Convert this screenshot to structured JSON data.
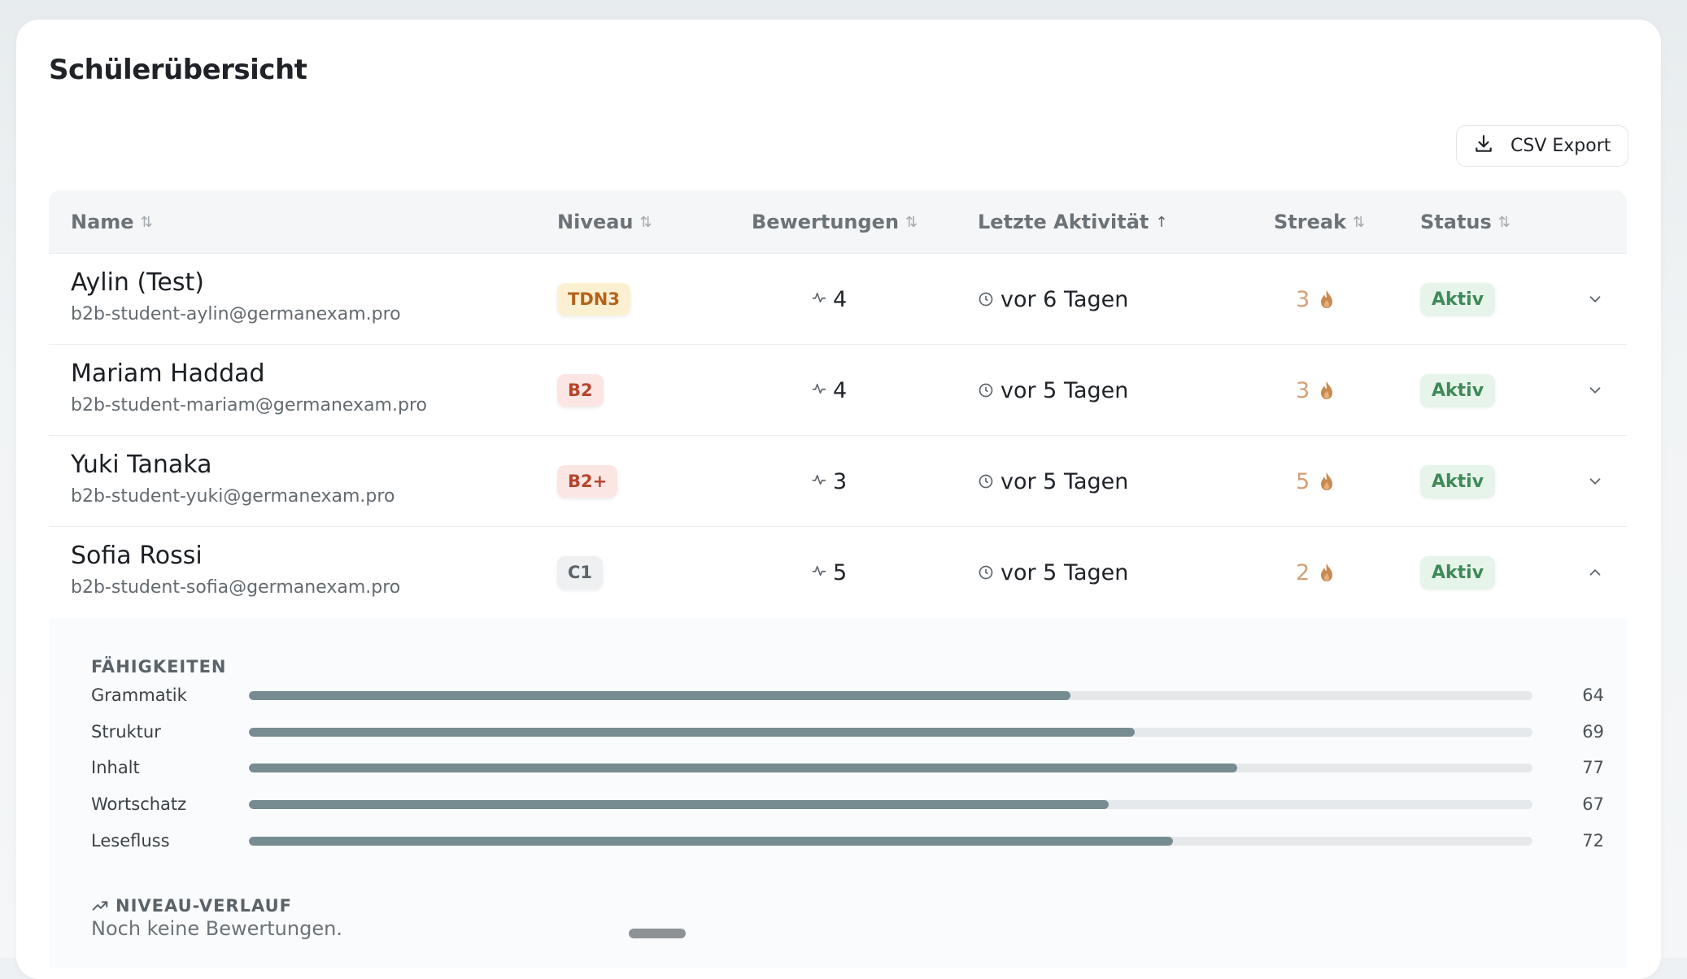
{
  "page": {
    "title": "Schülerübersicht"
  },
  "toolbar": {
    "export_label": "CSV Export"
  },
  "table": {
    "headers": {
      "name": "Name",
      "level": "Niveau",
      "ratings": "Bewertungen",
      "activity": "Letzte Aktivität",
      "streak": "Streak",
      "status": "Status"
    },
    "sort_icons": {
      "unsorted": "⇅",
      "ascending": "↑"
    },
    "rows": [
      {
        "name": "Aylin (Test)",
        "email": "b2b-student-aylin@germanexam.pro",
        "level": "TDN3",
        "ratings": "4",
        "activity": "vor 6 Tagen",
        "streak": "3",
        "status": "Aktiv"
      },
      {
        "name": "Mariam Haddad",
        "email": "b2b-student-mariam@germanexam.pro",
        "level": "B2",
        "ratings": "4",
        "activity": "vor 5 Tagen",
        "streak": "3",
        "status": "Aktiv"
      },
      {
        "name": "Yuki Tanaka",
        "email": "b2b-student-yuki@germanexam.pro",
        "level": "B2+",
        "ratings": "3",
        "activity": "vor 5 Tagen",
        "streak": "5",
        "status": "Aktiv"
      },
      {
        "name": "Sofia Rossi",
        "email": "b2b-student-sofia@germanexam.pro",
        "level": "C1",
        "ratings": "5",
        "activity": "vor 5 Tagen",
        "streak": "2",
        "status": "Aktiv"
      }
    ]
  },
  "details": {
    "skills_title": "FÄHIGKEITEN",
    "skills": [
      {
        "label": "Grammatik",
        "value": "64"
      },
      {
        "label": "Struktur",
        "value": "69"
      },
      {
        "label": "Inhalt",
        "value": "77"
      },
      {
        "label": "Wortschatz",
        "value": "67"
      },
      {
        "label": "Lesefluss",
        "value": "72"
      }
    ],
    "history_title": "NIVEAU-VERLAUF",
    "history_empty": "Noch keine Bewertungen."
  },
  "colors": {
    "level_tdn3_bg": "#fbf1d2",
    "level_tdn3_fg": "#b5621d",
    "level_b2_bg": "#fbe6e3",
    "level_b2_fg": "#b6452d",
    "level_c1_bg": "#eef0f2",
    "level_c1_fg": "#5b6469",
    "status_bg": "#e6f4ea",
    "status_fg": "#3f8a58",
    "streak": "#d59f74",
    "bar_fill": "#768c91"
  },
  "icons": {
    "export": "download-icon",
    "rating": "pulse-icon",
    "activity": "clock-icon",
    "streak": "flame-icon",
    "expand": "chevron-down-icon",
    "collapse": "chevron-up-icon",
    "history": "trend-up-icon"
  }
}
